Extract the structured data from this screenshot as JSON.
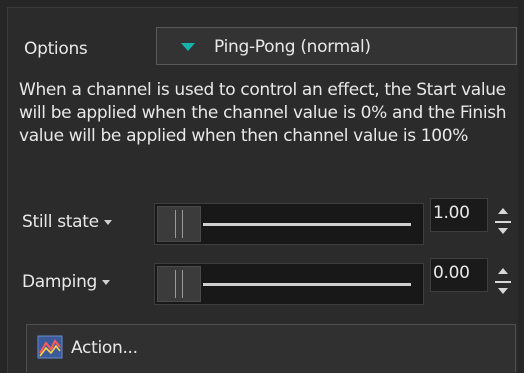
{
  "options": {
    "label": "Options",
    "selected": "Ping-Pong (normal)"
  },
  "description": "When a channel is used to control an effect, the Start value will be applied when the channel value is 0% and the Finish value will be applied when then channel value is 100%",
  "still_state": {
    "label": "Still state",
    "value": "1.00",
    "slider_level": 0.0
  },
  "damping": {
    "label": "Damping",
    "value": "0.00",
    "slider_level": 0.0
  },
  "action_button": {
    "label": "Action...",
    "icon": "chart-action-icon"
  },
  "colors": {
    "accent": "#14b3ad",
    "background": "#2b2b2b"
  }
}
